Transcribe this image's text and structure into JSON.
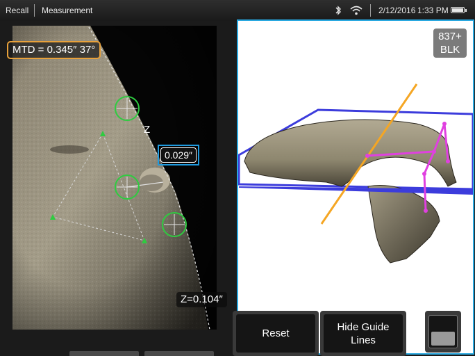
{
  "topbar": {
    "recall_label": "Recall",
    "mode_label": "Measurement",
    "date": "2/12/2016",
    "time": "1:33 PM",
    "icons": [
      "bluetooth-icon",
      "wifi-icon",
      "battery-icon"
    ]
  },
  "measurement": {
    "mtd_label": "MTD = 0.345″ 37°",
    "length_value": "0.029″",
    "z_axis_label": "Z",
    "z_value_label": "Z=0.104″"
  },
  "view3d": {
    "badge_line1": "837+",
    "badge_line2": "BLK"
  },
  "buttons": {
    "reset_label": "Reset",
    "hide_guide_lines_label": "Hide Guide Lines"
  },
  "colors": {
    "accent_blue": "#29a8e0",
    "mtd_border": "#e8a13a",
    "cursor_green": "#2ecc40",
    "plane_blue": "#3c3cdc",
    "axis_orange": "#f5a623",
    "profile_magenta": "#e040e0"
  }
}
